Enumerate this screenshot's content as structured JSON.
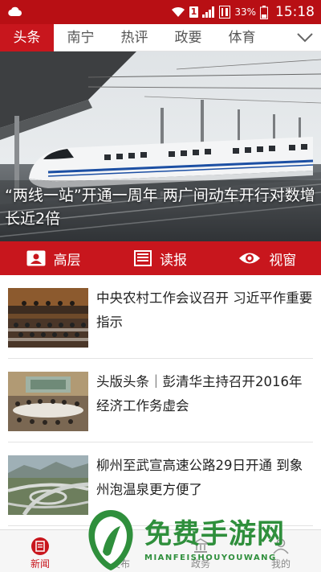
{
  "status_bar": {
    "sim_label": "1",
    "battery": "33%",
    "time": "15:18",
    "icons": [
      "cloud-icon",
      "wifi-icon",
      "sim-icon",
      "signal-icon",
      "hd-icon",
      "battery-icon"
    ]
  },
  "tabs": [
    {
      "label": "头条",
      "active": true
    },
    {
      "label": "南宁",
      "active": false
    },
    {
      "label": "热评",
      "active": false
    },
    {
      "label": "政要",
      "active": false
    },
    {
      "label": "体育",
      "active": false
    }
  ],
  "hero": {
    "caption": "“两线一站”开通一周年 两广间动车开行对数增长近2倍"
  },
  "quick_links": [
    {
      "label": "高层",
      "icon": "leader-icon"
    },
    {
      "label": "读报",
      "icon": "newspaper-icon"
    },
    {
      "label": "视窗",
      "icon": "eye-icon"
    }
  ],
  "news": [
    {
      "title": "中央农村工作会议召开 习近平作重要指示"
    },
    {
      "title": "头版头条｜彭清华主持召开2016年经济工作务虚会"
    },
    {
      "title": "柳州至武宣高速公路29日开通 到象州泡温泉更方便了"
    }
  ],
  "bottom_nav": [
    {
      "label": "新闻",
      "icon": "news-icon",
      "active": true
    },
    {
      "label": "发布",
      "icon": "publish-icon",
      "active": false
    },
    {
      "label": "政务",
      "icon": "government-icon",
      "active": false
    },
    {
      "label": "我的",
      "icon": "profile-icon",
      "active": false
    }
  ],
  "watermark": {
    "title": "免费手游网",
    "subtitle": "MIANFEISHOUYOUWANG"
  },
  "colors": {
    "brand_red": "#c8161d",
    "status_red": "#b80f14",
    "watermark_green": "#2f8f3c"
  }
}
